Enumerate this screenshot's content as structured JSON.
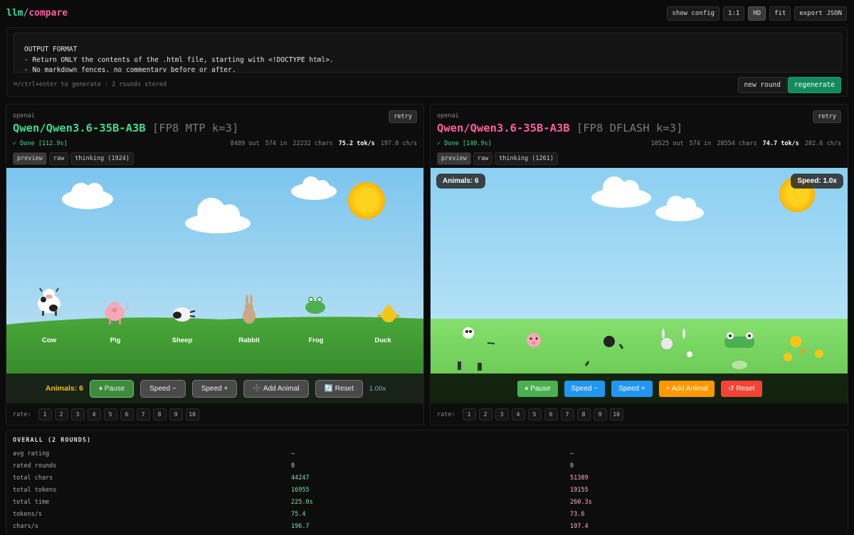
{
  "app": {
    "logo_a": "llm",
    "logo_sep": "/",
    "logo_b": "compare"
  },
  "toolbar": {
    "show_config": "show config",
    "one_to_one": "1:1",
    "hd": "HD",
    "fit": "fit",
    "export": "export JSON"
  },
  "prompt": {
    "text": "OUTPUT FORMAT\n- Return ONLY the contents of the .html file, starting with <!DOCTYPE html>.\n- No markdown fences, no commentary before or after.",
    "hint": "⌘/ctrl+enter to generate · 2 rounds stored",
    "new_round": "new round",
    "regenerate": "regenerate"
  },
  "panels": [
    {
      "provider": "openai",
      "retry": "retry",
      "model": "Qwen/Qwen3.6-35B-A3B",
      "quant": "[FP8 MTP k=3]",
      "status": "✓ Done [112.9s]",
      "stats": {
        "out": "8489 out",
        "in": "574 in",
        "chars": "22232 chars",
        "toks": "75.2 tok/s",
        "chs": "197.0 ch/s"
      },
      "tabs": [
        "preview",
        "raw",
        "thinking (1924)"
      ],
      "scene": {
        "labels": [
          "Cow",
          "Pig",
          "Sheep",
          "Rabbit",
          "Frog",
          "Duck"
        ],
        "count": "Animals: 6",
        "pause": "⏸ Pause",
        "speed_minus": "Speed −",
        "speed_plus": "Speed +",
        "add": "➕ Add Animal",
        "reset": "🔄 Reset",
        "speed": "1.00x"
      },
      "rate_label": "rate:"
    },
    {
      "provider": "openai",
      "retry": "retry",
      "model": "Qwen/Qwen3.6-35B-A3B",
      "quant": "[FP8 DFLASH k=3]",
      "status": "✓ Done [140.9s]",
      "stats": {
        "out": "10525 out",
        "in": "574 in",
        "chars": "28554 chars",
        "toks": "74.7 tok/s",
        "chs": "202.6 ch/s"
      },
      "tabs": [
        "preview",
        "raw",
        "thinking (1261)"
      ],
      "scene": {
        "count": "Animals: 6",
        "speed": "Speed: 1.0x",
        "pause": "⏸ Pause",
        "speed_minus": "Speed −",
        "speed_plus": "Speed +",
        "add": "+ Add Animal",
        "reset": "↺ Reset"
      },
      "rate_label": "rate:"
    }
  ],
  "rate_buttons": [
    "1",
    "2",
    "3",
    "4",
    "5",
    "6",
    "7",
    "8",
    "9",
    "10"
  ],
  "overall": {
    "title": "OVERALL (2 ROUNDS)",
    "rows": [
      {
        "label": "avg rating",
        "a": "—",
        "b": "—"
      },
      {
        "label": "rated rounds",
        "a": "0",
        "b": "0"
      },
      {
        "label": "total chars",
        "a": "44247",
        "b": "51389"
      },
      {
        "label": "total tokens",
        "a": "16955",
        "b": "19155"
      },
      {
        "label": "total time",
        "a": "225.0s",
        "b": "260.3s"
      },
      {
        "label": "tokens/s",
        "a": "75.4",
        "b": "73.6"
      },
      {
        "label": "chars/s",
        "a": "196.7",
        "b": "197.4"
      }
    ]
  },
  "colors": {
    "green": "#3ddc97",
    "pink": "#ff5fa2",
    "regen": "#138a5d"
  }
}
